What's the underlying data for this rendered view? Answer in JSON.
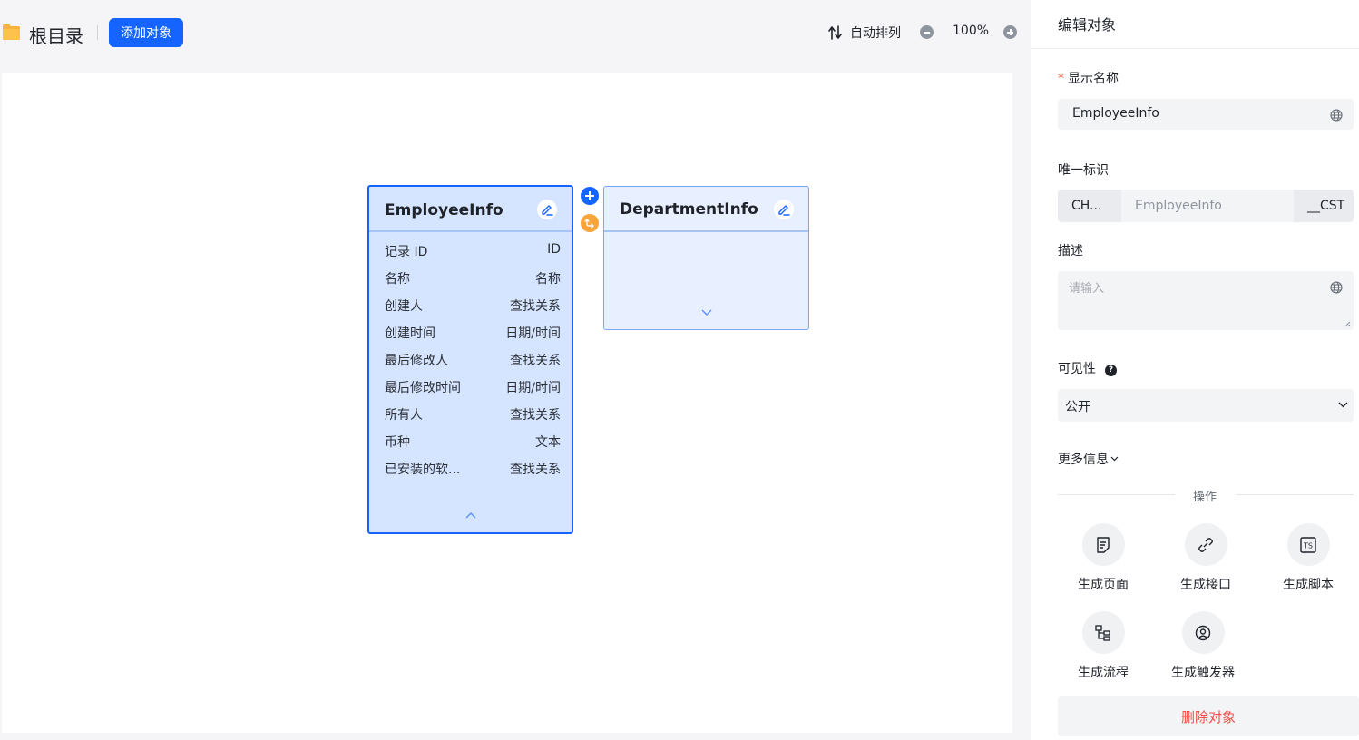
{
  "header": {
    "root_title": "根目录",
    "add_button": "添加对象",
    "auto_arrange": "自动排列",
    "zoom": "100%"
  },
  "entities": {
    "employee": {
      "title": "EmployeeInfo",
      "fields": [
        {
          "name": "记录 ID",
          "type": "ID"
        },
        {
          "name": "名称",
          "type": "名称"
        },
        {
          "name": "创建人",
          "type": "查找关系"
        },
        {
          "name": "创建时间",
          "type": "日期/时间"
        },
        {
          "name": "最后修改人",
          "type": "查找关系"
        },
        {
          "name": "最后修改时间",
          "type": "日期/时间"
        },
        {
          "name": "所有人",
          "type": "查找关系"
        },
        {
          "name": "币种",
          "type": "文本"
        },
        {
          "name": "已安装的软...",
          "type": "查找关系"
        }
      ]
    },
    "department": {
      "title": "DepartmentInfo"
    }
  },
  "panel": {
    "title": "编辑对象",
    "display_name_label": "显示名称",
    "display_name_value": "EmployeeInfo",
    "unique_id_label": "唯一标识",
    "unique_id_prefix": "CH...",
    "unique_id_value": "EmployeeInfo",
    "unique_id_suffix": "__CST",
    "description_label": "描述",
    "description_placeholder": "请输入",
    "visibility_label": "可见性",
    "visibility_value": "公开",
    "more_info": "更多信息",
    "operations_title": "操作",
    "operations": [
      {
        "label": "生成页面",
        "icon": "page-icon"
      },
      {
        "label": "生成接口",
        "icon": "link-icon"
      },
      {
        "label": "生成脚本",
        "icon": "ts-script-icon"
      },
      {
        "label": "生成流程",
        "icon": "flow-icon"
      },
      {
        "label": "生成触发器",
        "icon": "trigger-icon"
      }
    ],
    "delete_button": "删除对象"
  },
  "colors": {
    "primary": "#1664ff",
    "danger": "#f54a45",
    "relation": "#f7a53a",
    "card_selected": "#d6e5ff"
  }
}
